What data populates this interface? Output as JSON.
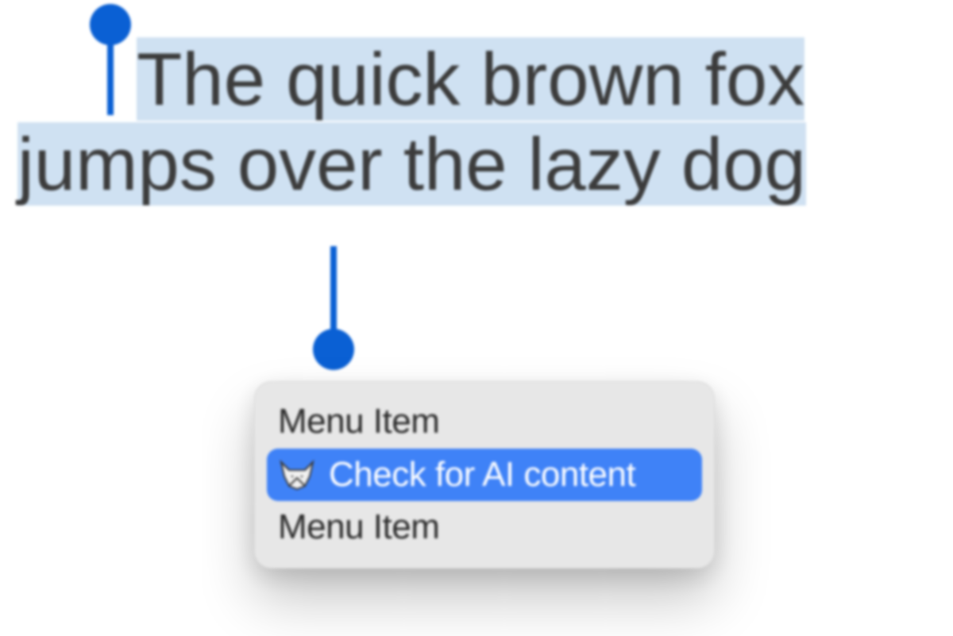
{
  "selection": {
    "text": "The quick brown fox jumps over the lazy dog"
  },
  "menu": {
    "items": [
      {
        "label": "Menu Item",
        "selected": false
      },
      {
        "label": "Check for AI content",
        "selected": true,
        "icon": "fox-icon"
      },
      {
        "label": "Menu Item",
        "selected": false
      }
    ]
  },
  "colors": {
    "selection_bg": "#cfe1f2",
    "handle": "#0a60d4",
    "menu_bg": "#e7e7e7",
    "menu_highlight": "#3f82f7"
  }
}
